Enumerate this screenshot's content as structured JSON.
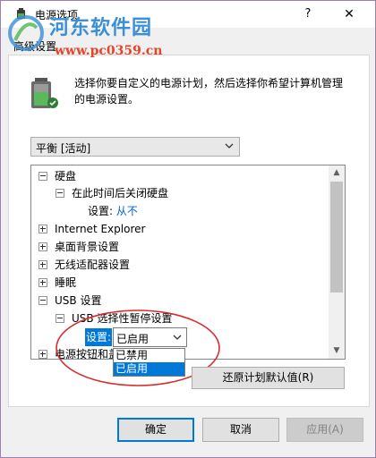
{
  "window": {
    "title": "电源选项",
    "help_label": "?",
    "close_label": "✕",
    "tab_label": "高级设置",
    "icon": "power-options-icon"
  },
  "watermark": {
    "line1": "河东软件园",
    "line2": "www.pc0359.cn"
  },
  "description": "选择你要自定义的电源计划，然后选择你希望计算机管理的电源设置。",
  "plan_select": {
    "value": "平衡 [活动]"
  },
  "tree": {
    "rows": [
      {
        "label": "硬盘",
        "expander": "minus"
      },
      {
        "label": "在此时间后关闭硬盘",
        "expander": "minus"
      },
      {
        "label": "设置:",
        "link": "从不"
      },
      {
        "label": "Internet Explorer",
        "expander": "plus"
      },
      {
        "label": "桌面背景设置",
        "expander": "plus"
      },
      {
        "label": "无线适配器设置",
        "expander": "plus"
      },
      {
        "label": "睡眠",
        "expander": "plus"
      },
      {
        "label": "USB 设置",
        "expander": "minus"
      },
      {
        "label": "USB 选择性暂停设置",
        "expander": "minus"
      },
      {
        "label": "电源按钮和盖",
        "expander": "plus"
      }
    ]
  },
  "usb_setting": {
    "label": "设置:",
    "value": "已启用",
    "options": [
      "已禁用",
      "已启用"
    ],
    "selected_index": 1
  },
  "buttons": {
    "restore": "还原计划默认值(R)",
    "ok": "确定",
    "cancel": "取消",
    "apply": "应用(A)"
  },
  "colors": {
    "accent": "#0078d7",
    "link": "#0066cc",
    "annotation": "#d92b2b",
    "window_border": "#9b7fb5"
  }
}
